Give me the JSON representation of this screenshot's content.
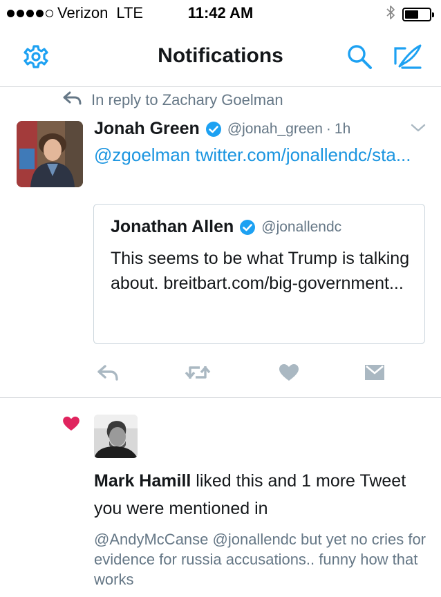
{
  "status_bar": {
    "carrier": "Verizon",
    "network": "LTE",
    "time": "11:42 AM",
    "signal_bars_filled": 4,
    "signal_bars_total": 5,
    "battery_level": 0.55
  },
  "nav": {
    "title": "Notifications",
    "accent_color": "#1da1f2"
  },
  "tweet_notification": {
    "reply_context": "In reply to Zachary Goelman",
    "author_name": "Jonah Green",
    "author_handle": "@jonah_green",
    "separator": "·",
    "age": "1h",
    "text": "@zgoelman twitter.com/jonallendc/sta...",
    "quoted": {
      "author_name": "Jonathan Allen",
      "author_handle": "@jonallendc",
      "text": "This seems to be what Trump is talking about. breitbart.com/big-government..."
    },
    "actions": [
      "reply-icon",
      "retweet-icon",
      "like-icon",
      "direct-message-icon"
    ]
  },
  "like_notification": {
    "liker_name": "Mark Hamill",
    "summary": " liked this and 1 more Tweet you were mentioned in",
    "liked_tweet_text": "@AndyMcCanse @jonallendc but yet no cries for evidence for russia accusations.. funny how that works",
    "heart_color": "#e0245e"
  }
}
